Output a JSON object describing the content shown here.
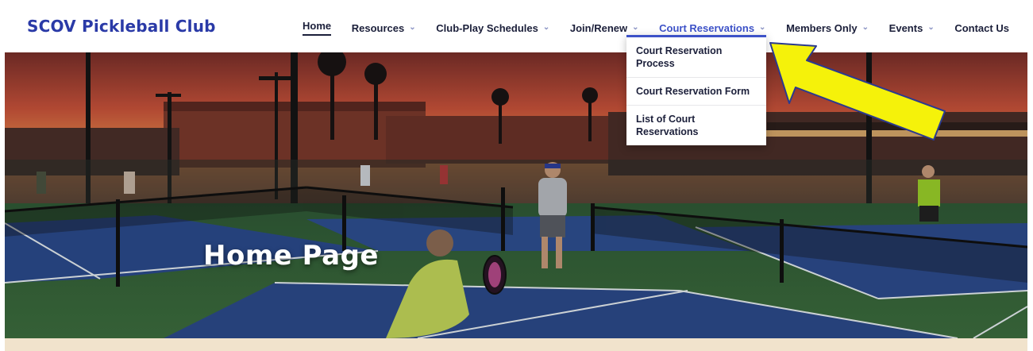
{
  "site": {
    "logo_text": "SCOV Pickleball Club"
  },
  "nav": {
    "items": [
      {
        "label": "Home",
        "has_dropdown": false
      },
      {
        "label": "Resources",
        "has_dropdown": true
      },
      {
        "label": "Club-Play Schedules",
        "has_dropdown": true
      },
      {
        "label": "Join/Renew",
        "has_dropdown": true
      },
      {
        "label": "Court Reservations",
        "has_dropdown": true
      },
      {
        "label": "Members Only",
        "has_dropdown": true
      },
      {
        "label": "Events",
        "has_dropdown": true
      },
      {
        "label": "Contact Us",
        "has_dropdown": false
      }
    ],
    "active": "Home",
    "open_menu": "Court Reservations"
  },
  "dropdown": {
    "items": [
      {
        "label": "Court Reservation Process"
      },
      {
        "label": "Court Reservation Form"
      },
      {
        "label": "List of Court Reservations"
      }
    ]
  },
  "hero": {
    "title": "Home Page"
  },
  "colors": {
    "brand": "#2a3aa7",
    "nav_text": "#1b1f3a",
    "nav_open": "#3d52c8",
    "annotation_arrow": "#f5f20a",
    "strip": "#f1e3cc"
  },
  "icons": {
    "dropdown_chevron": "chevron-down-icon",
    "annotation": "yellow-arrow-icon"
  }
}
